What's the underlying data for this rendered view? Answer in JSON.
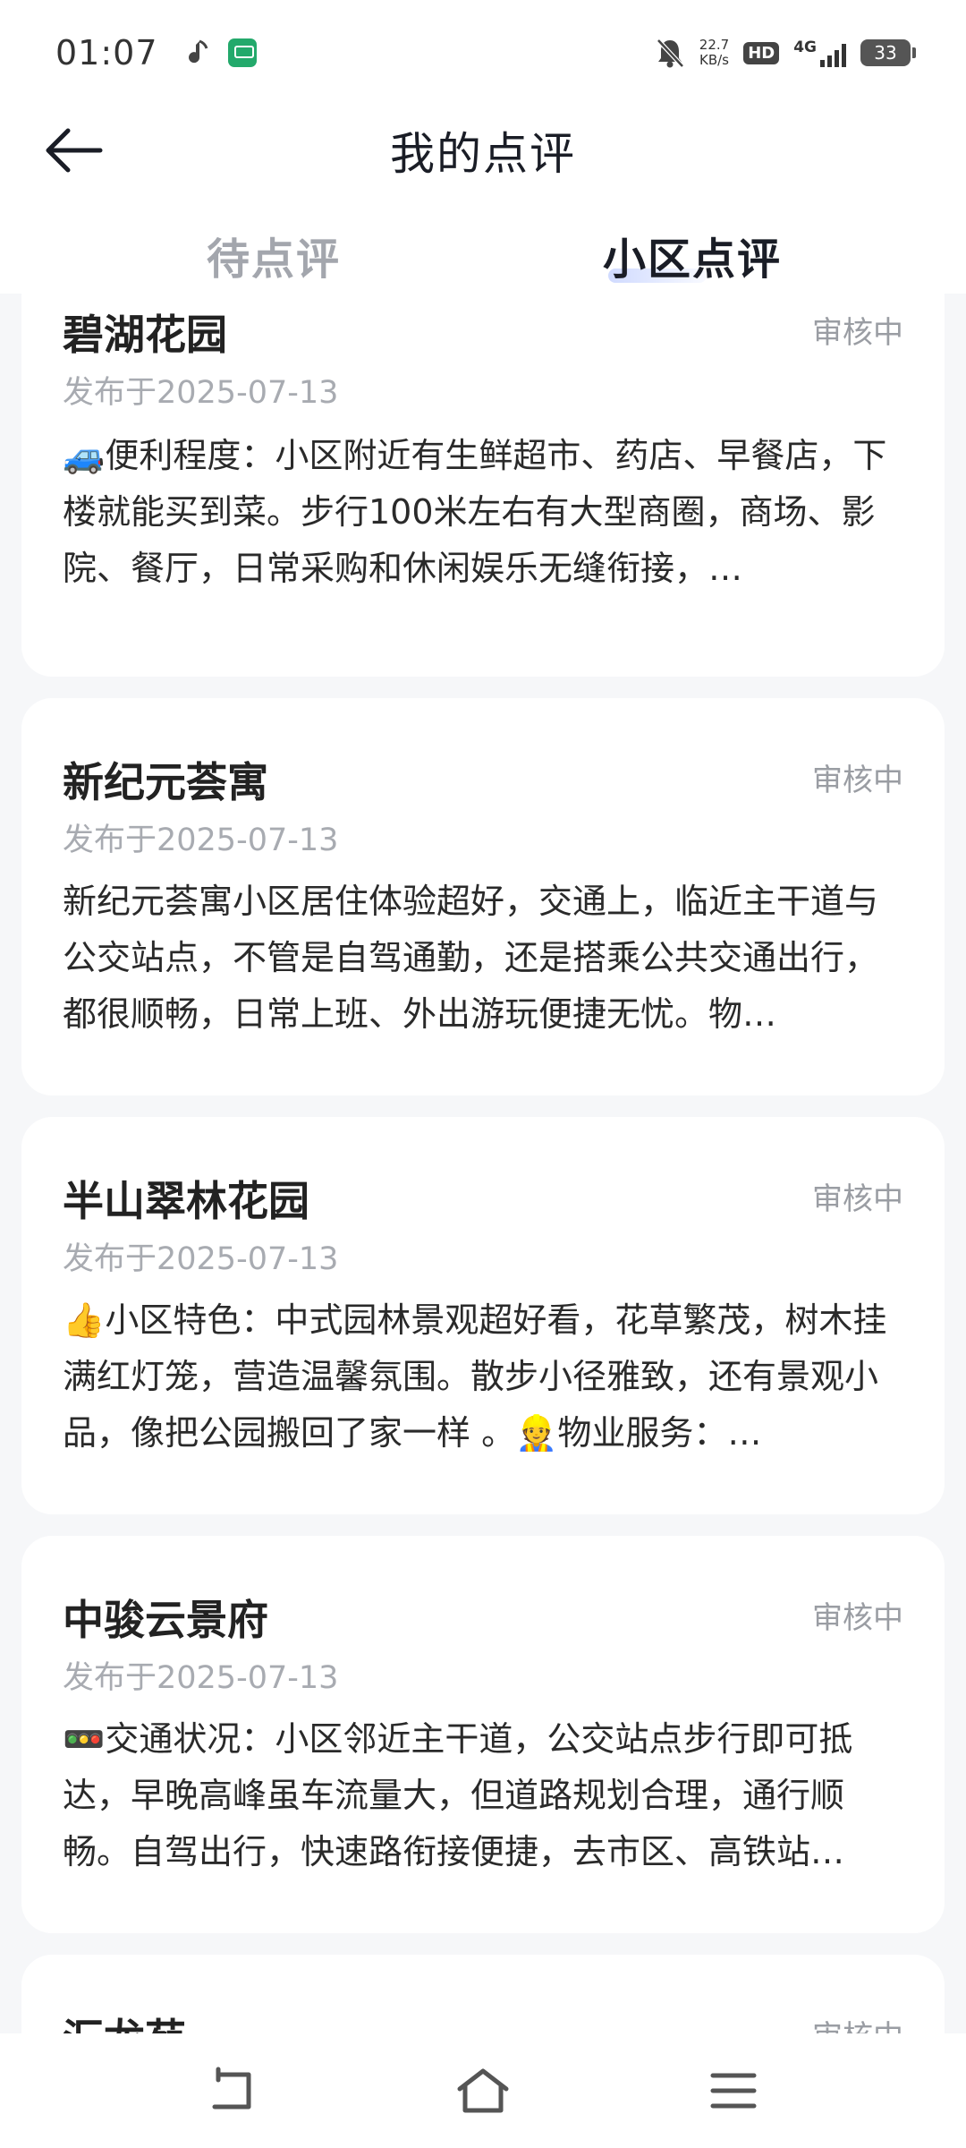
{
  "status_bar": {
    "time": "01:07",
    "speed_value": "22.7",
    "speed_unit": "KB/s",
    "hd": "HD",
    "network": "4G",
    "battery": "33"
  },
  "header": {
    "title": "我的点评",
    "tabs": [
      {
        "label": "待点评",
        "active": false
      },
      {
        "label": "小区点评",
        "active": true
      }
    ]
  },
  "reviews": [
    {
      "name": "碧湖花园",
      "status": "审核中",
      "date": "发布于2025-07-13",
      "content": "🚙便利程度：小区附近有生鲜超市、药店、早餐店，下楼就能买到菜。步行100米左右有大型商圈，商场、影院、餐厅，日常采购和休闲娱乐无缝衔接，…"
    },
    {
      "name": "新纪元荟寓",
      "status": "审核中",
      "date": "发布于2025-07-13",
      "content": "新纪元荟寓小区居住体验超好，交通上，临近主干道与公交站点，不管是自驾通勤，还是搭乘公共交通出行，都很顺畅，日常上班、外出游玩便捷无忧。物…"
    },
    {
      "name": "半山翠林花园",
      "status": "审核中",
      "date": "发布于2025-07-13",
      "content": "👍小区特色：中式园林景观超好看，花草繁茂，树木挂满红灯笼，营造温馨氛围。散步小径雅致，还有景观小品，像把公园搬回了家一样 。👷物业服务：…"
    },
    {
      "name": "中骏云景府",
      "status": "审核中",
      "date": "发布于2025-07-13",
      "content": "🚥交通状况：小区邻近主干道，公交站点步行即可抵达，早晚高峰虽车流量大，但道路规划合理，通行顺畅。自驾出行，快速路衔接便捷，去市区、高铁站…"
    },
    {
      "name": "汇龙苑",
      "status": "审核中",
      "date": "",
      "content": ""
    }
  ]
}
